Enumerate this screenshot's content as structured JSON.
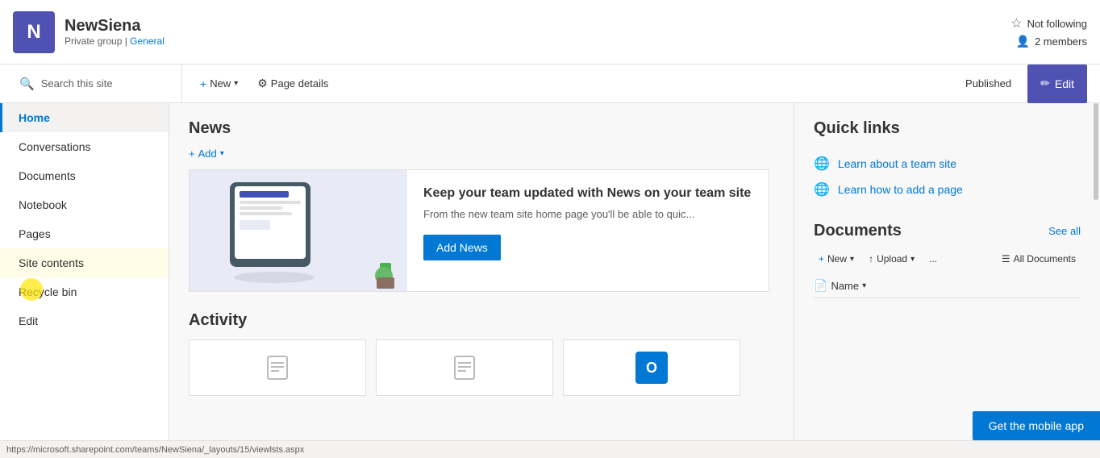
{
  "site": {
    "logo_letter": "N",
    "name": "NewSiena",
    "meta_group": "Private group",
    "meta_separator": " | ",
    "meta_general": "General"
  },
  "header_right": {
    "follow_label": "Not following",
    "members_label": "2 members"
  },
  "toolbar": {
    "new_label": "New",
    "page_details_label": "Page details",
    "published_label": "Published",
    "edit_label": "Edit"
  },
  "sidebar": {
    "items": [
      {
        "label": "Home",
        "active": true
      },
      {
        "label": "Conversations",
        "active": false
      },
      {
        "label": "Documents",
        "active": false
      },
      {
        "label": "Notebook",
        "active": false
      },
      {
        "label": "Pages",
        "active": false
      },
      {
        "label": "Site contents",
        "active": false,
        "highlighted": true
      },
      {
        "label": "Recycle bin",
        "active": false
      },
      {
        "label": "Edit",
        "active": false
      }
    ]
  },
  "news": {
    "title": "News",
    "add_label": "Add",
    "card": {
      "title": "Keep your team updated with News on your team site",
      "description": "From the new team site home page you'll be able to quic...",
      "add_news_label": "Add News"
    }
  },
  "activity": {
    "title": "Activity"
  },
  "quick_links": {
    "title": "Quick links",
    "items": [
      {
        "label": "Learn about a team site"
      },
      {
        "label": "Learn how to add a page"
      }
    ]
  },
  "documents": {
    "title": "Documents",
    "see_all_label": "See all",
    "new_label": "New",
    "upload_label": "Upload",
    "more_label": "...",
    "all_docs_label": "All Documents",
    "name_label": "Name"
  },
  "status_bar": {
    "url": "https://microsoft.sharepoint.com/teams/NewSiena/_layouts/15/viewlsts.aspx"
  },
  "mobile_banner": {
    "label": "Get the mobile app"
  }
}
